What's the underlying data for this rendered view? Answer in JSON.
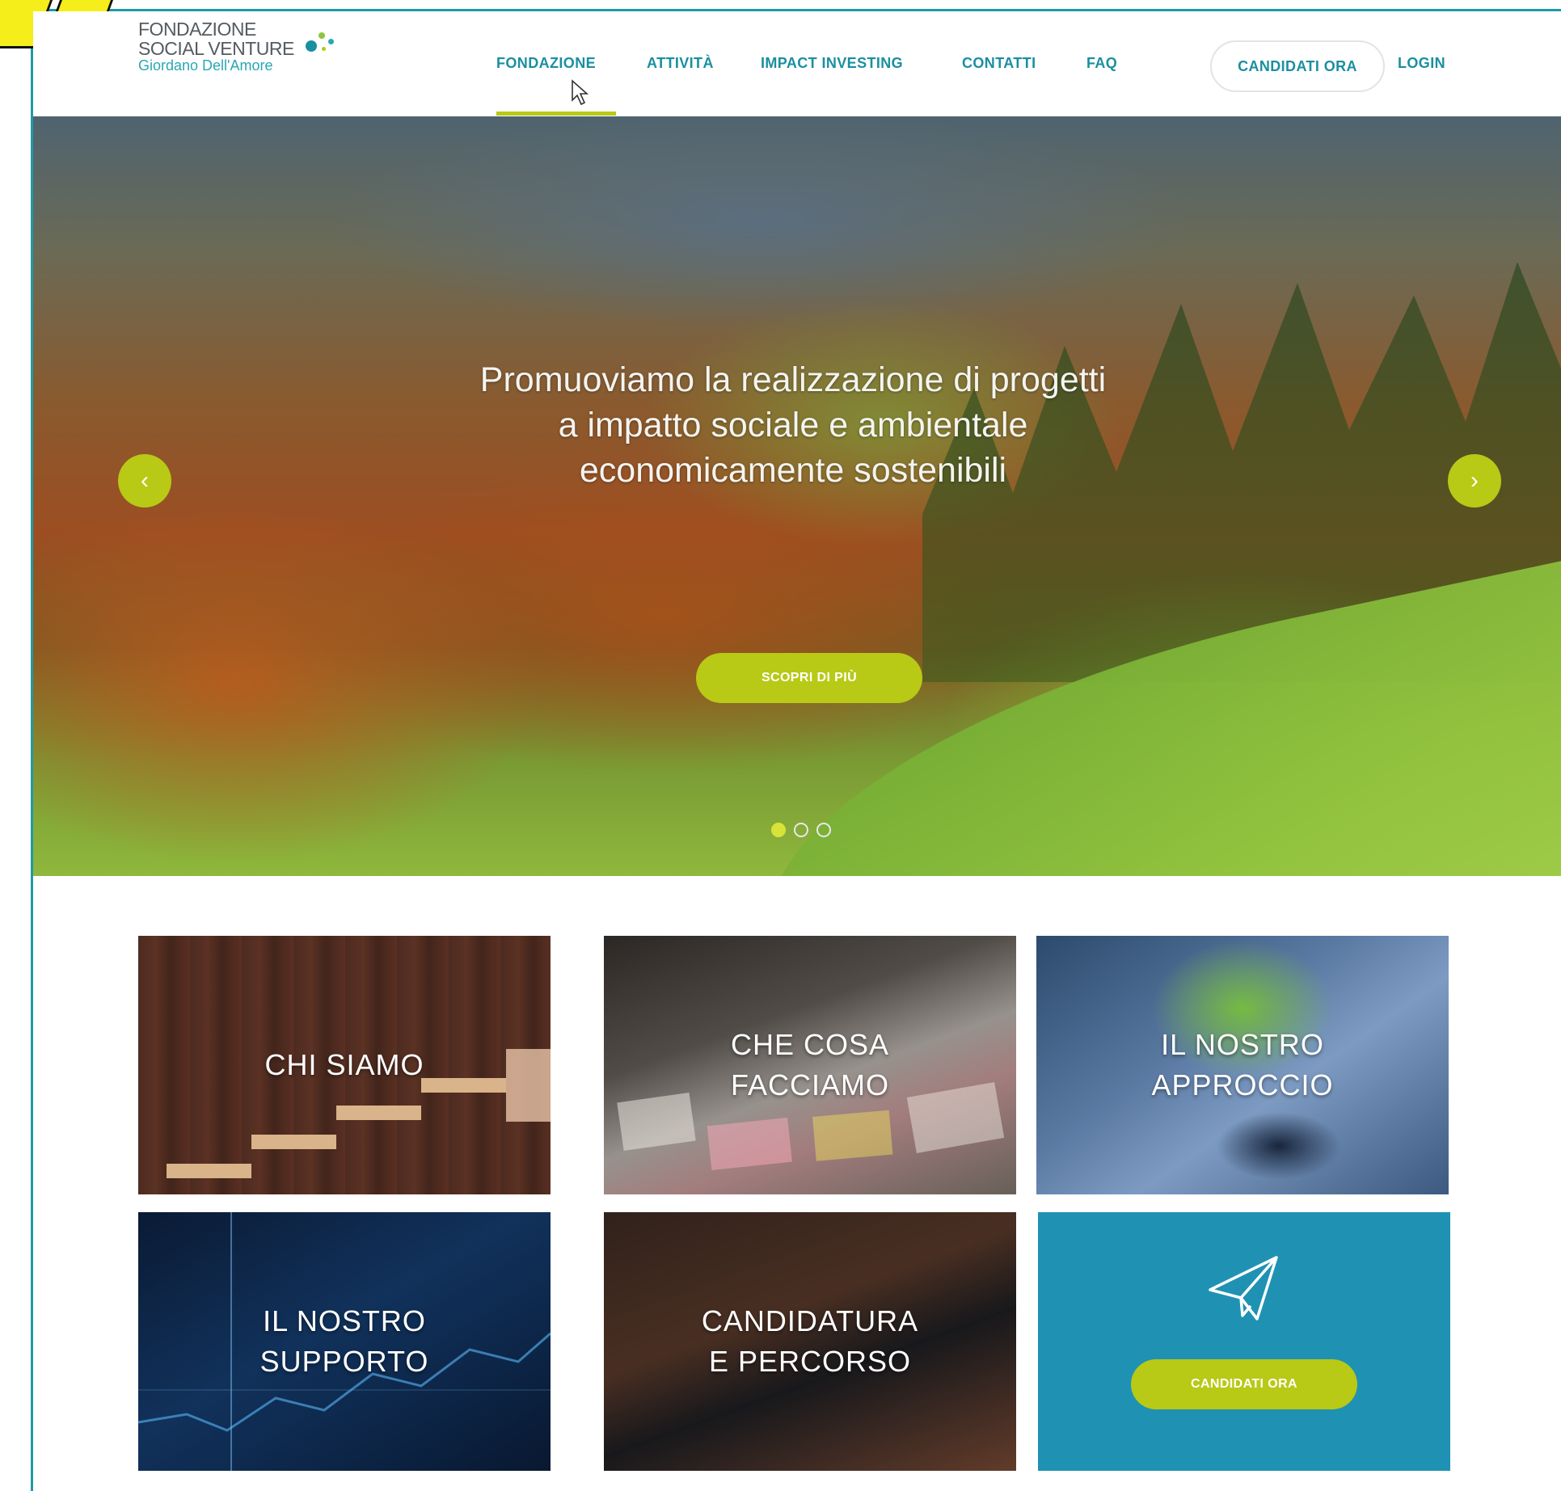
{
  "logo": {
    "line1": "FONDAZIONE",
    "line2": "SOCIAL VENTURE",
    "line3": "Giordano Dell'Amore"
  },
  "nav": {
    "items": [
      "FONDAZIONE",
      "ATTIVITÀ",
      "IMPACT INVESTING",
      "CONTATTI",
      "FAQ"
    ],
    "active": "FONDAZIONE",
    "apply_label": "CANDIDATI ORA",
    "login_label": "LOGIN"
  },
  "hero": {
    "headline_lines": [
      "Promuoviamo la realizzazione di progetti",
      "a impatto sociale e ambientale",
      "economicamente sostenibili"
    ],
    "cta_label": "SCOPRI DI PIÙ",
    "prev_icon": "‹",
    "next_icon": "›",
    "slide_count": 3,
    "active_slide": 1
  },
  "tiles": {
    "chi_siamo": [
      "CHI SIAMO"
    ],
    "che_cosa_facciamo": [
      "CHE COSA",
      "FACCIAMO"
    ],
    "il_nostro_approccio": [
      "IL NOSTRO",
      "APPROCCIO"
    ],
    "il_nostro_supporto": [
      "IL NOSTRO",
      "SUPPORTO"
    ],
    "candidatura_e_percorso": [
      "CANDIDATURA",
      "E PERCORSO"
    ],
    "apply_button": "CANDIDATI ORA",
    "apply_icon": "paper-plane-icon"
  },
  "colors": {
    "accent_green": "#b8c916",
    "nav_teal": "#1a8fa0",
    "apply_tile_blue": "#1f92b3"
  }
}
